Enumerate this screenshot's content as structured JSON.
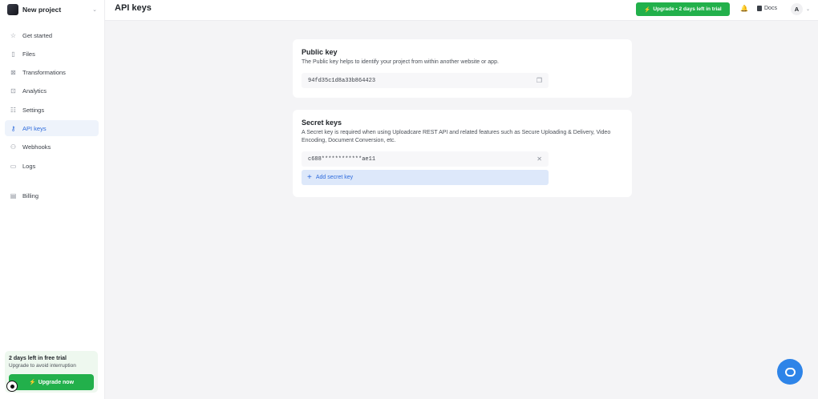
{
  "project": {
    "name": "New project"
  },
  "header": {
    "title": "API keys",
    "upgrade_label": "Upgrade • 2 days left in trial",
    "docs_label": "Docs",
    "avatar_initial": "A"
  },
  "sidebar": {
    "items": [
      {
        "label": "Get started",
        "icon": "star-icon"
      },
      {
        "label": "Files",
        "icon": "file-icon"
      },
      {
        "label": "Transformations",
        "icon": "transform-icon"
      },
      {
        "label": "Analytics",
        "icon": "analytics-icon"
      },
      {
        "label": "Settings",
        "icon": "settings-icon"
      },
      {
        "label": "API keys",
        "icon": "key-icon",
        "active": true
      },
      {
        "label": "Webhooks",
        "icon": "webhook-icon"
      },
      {
        "label": "Logs",
        "icon": "logs-icon"
      },
      {
        "label": "Billing",
        "icon": "billing-icon"
      }
    ],
    "trial": {
      "title": "2 days left in free trial",
      "subtitle": "Upgrade to avoid interruption",
      "button_label": "Upgrade now"
    }
  },
  "public_key": {
    "title": "Public key",
    "description": "The Public key helps to identify your project from within another website or app.",
    "value": "94fd35c1d8a33b864423"
  },
  "secret_keys": {
    "title": "Secret keys",
    "description": "A Secret key is required when using Uploadcare REST API and related features such as Secure Uploading & Delivery, Video Encoding, Document Conversion, etc.",
    "keys": [
      "c688************ae11"
    ],
    "add_label": "Add secret key"
  },
  "colors": {
    "accent": "#2e6bdc",
    "success": "#22b04b",
    "chat": "#2e84e8"
  }
}
